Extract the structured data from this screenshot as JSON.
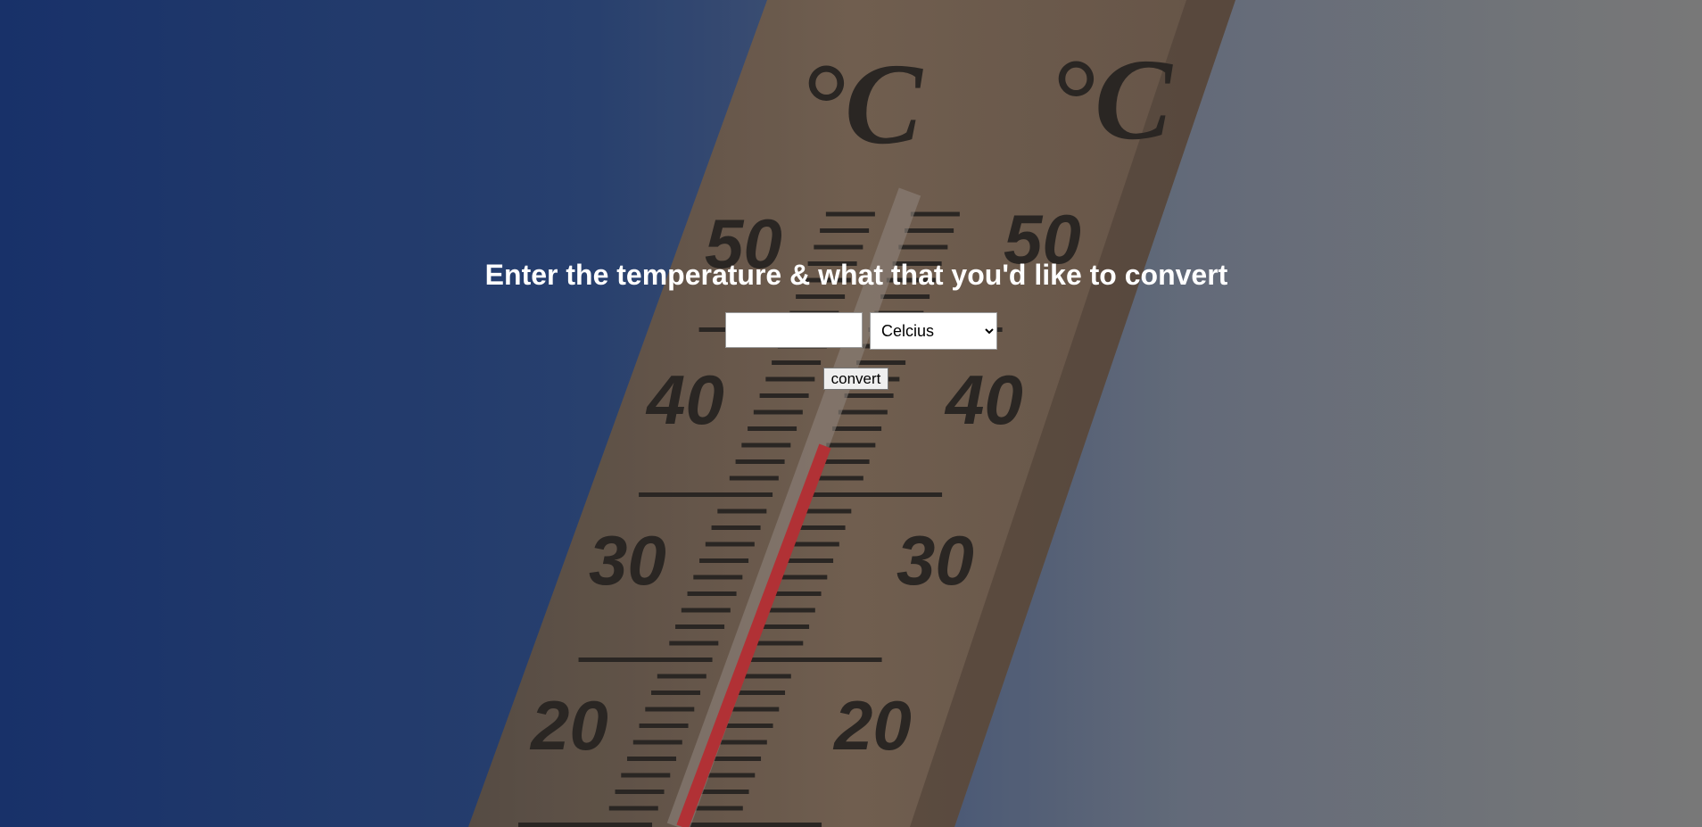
{
  "header": {
    "title": "Enter the temperature & what that you'd like to convert"
  },
  "form": {
    "temperature_value": "",
    "temperature_placeholder": "",
    "unit_selected": "Celcius",
    "convert_label": "convert"
  },
  "background": {
    "unit_marks": [
      "°C",
      "°C"
    ],
    "scale_labels": [
      "50",
      "40",
      "30",
      "20"
    ],
    "colors": {
      "sky_left": "#1e3a78",
      "sky_right": "#808080",
      "wood": "#6b5a4a",
      "mercury": "#c0363a"
    }
  }
}
